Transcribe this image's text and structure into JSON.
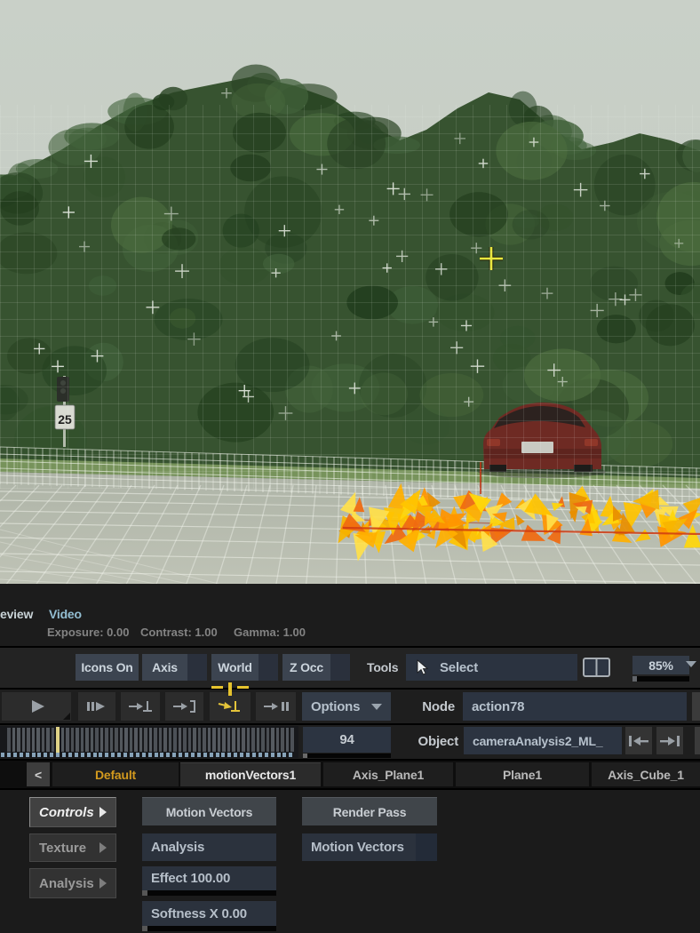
{
  "viewport": {
    "sign_text": "25"
  },
  "preview_bar": {
    "preview_tab_partial": "eview",
    "video_tab": "Video",
    "exposure": "Exposure: 0.00",
    "contrast": "Contrast: 1.00",
    "gamma": "Gamma: 1.00"
  },
  "toolbar": {
    "icons_on": "Icons On",
    "axis": "Axis",
    "world": "World",
    "z_occ": "Z Occ",
    "tools": "Tools",
    "select": "Select",
    "zoom_level": "85%"
  },
  "transport": {
    "options": "Options",
    "node_label": "Node",
    "node_value": "action78",
    "frame_value": "94",
    "object_label": "Object",
    "object_value": "cameraAnalysis2_ML_"
  },
  "tabs": {
    "back_label": "<",
    "items": [
      {
        "label": "Default"
      },
      {
        "label": "motionVectors1"
      },
      {
        "label": "Axis_Plane1"
      },
      {
        "label": "Plane1"
      },
      {
        "label": "Axis_Cube_1"
      }
    ]
  },
  "panel": {
    "sections": [
      {
        "label": "Controls"
      },
      {
        "label": "Texture"
      },
      {
        "label": "Analysis"
      }
    ],
    "motion_vectors_button": "Motion Vectors",
    "render_pass_button": "Render Pass",
    "analysis_toggle": "Analysis",
    "motion_vectors_select": "Motion Vectors",
    "effect_field": "Effect 100.00",
    "softness_field": "Softness X 0.00"
  },
  "icons": {
    "select-cursor-icon": "arrow-pointer",
    "split-view-icon": "two-pane-rectangle",
    "play-icon": "triangle-right",
    "play-step-icon": "bars+triangle",
    "goto-keyframe-icon": "arrow-to-ground",
    "goto-bracket-icon": "arrow-to-bracket",
    "goto-keyframe-active-icon": "arrow-to-ground-yellow",
    "goto-pause-icon": "arrow-to-pause",
    "jump-first-icon": "bar-arrow-left",
    "jump-last-icon": "arrow-bar-right",
    "dropdown-arrow-icon": "triangle-down",
    "section-arrow-icon": "triangle-right"
  },
  "colors": {
    "accent_yellow": "#e6c32e",
    "active_tab_orange": "#d4981f",
    "video_tab_blue": "#93bed2",
    "button_blue_gray": "#3c4450",
    "field_navy": "#2c3441",
    "cone_yellow": "#ffd60a",
    "cone_orange": "#ffaa00",
    "vector_line_red": "#cf3a12"
  }
}
